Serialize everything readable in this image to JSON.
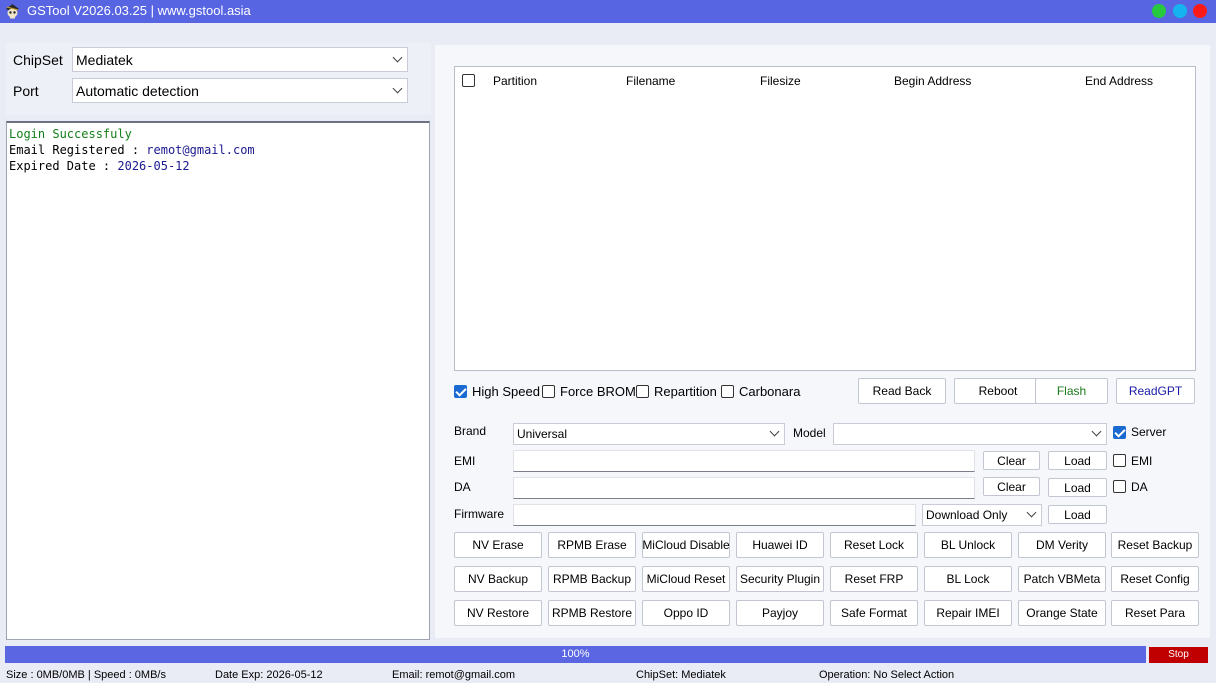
{
  "window": {
    "title": "GSTool V2026.03.25 | www.gstool.asia",
    "app_icon": "pirate-skull-icon",
    "controls": [
      {
        "name": "maximize",
        "color": "#27c93f"
      },
      {
        "name": "minimize",
        "color": "#15b4f0"
      },
      {
        "name": "close",
        "color": "#ff1a1a"
      }
    ]
  },
  "connection": {
    "chipset_label": "ChipSet",
    "chipset_value": "Mediatek",
    "port_label": "Port",
    "port_value": "Automatic detection"
  },
  "log": {
    "line1": "Login Successfuly",
    "line2_key": "Email Registered : ",
    "line2_value": "remot@gmail.com",
    "line3_key": "Expired Date : ",
    "line3_value": "2026-05-12"
  },
  "partition_table": {
    "headers": [
      "Partition",
      "Filename",
      "Filesize",
      "Begin Address",
      "End Address"
    ],
    "select_all_checked": false
  },
  "options": {
    "high_speed": {
      "label": "High Speed",
      "checked": true
    },
    "force_brom": {
      "label": "Force BROM",
      "checked": false
    },
    "repartition": {
      "label": "Repartition",
      "checked": false
    },
    "carbonara": {
      "label": "Carbonara",
      "checked": false
    }
  },
  "actions": {
    "read_back": "Read Back",
    "reboot": "Reboot",
    "flash": "Flash",
    "read_gpt": "ReadGPT"
  },
  "form": {
    "brand_label": "Brand",
    "brand_value": "Universal",
    "model_label": "Model",
    "model_value": "",
    "server": {
      "label": "Server",
      "checked": true
    },
    "emi_label": "EMI",
    "emi_value": "",
    "emi_check": {
      "label": "EMI",
      "checked": false
    },
    "da_label": "DA",
    "da_value": "",
    "da_check": {
      "label": "DA",
      "checked": false
    },
    "firmware_label": "Firmware",
    "firmware_value": "",
    "firmware_mode": "Download Only",
    "clear_label": "Clear",
    "load_label": "Load"
  },
  "functions": {
    "row1": [
      "NV Erase",
      "RPMB Erase",
      "MiCloud Disable",
      "Huawei ID",
      "Reset Lock",
      "BL Unlock",
      "DM Verity",
      "Reset Backup"
    ],
    "row2": [
      "NV Backup",
      "RPMB Backup",
      "MiCloud Reset",
      "Security Plugin",
      "Reset FRP",
      "BL Lock",
      "Patch VBMeta",
      "Reset Config"
    ],
    "row3": [
      "NV Restore",
      "RPMB Restore",
      "Oppo ID",
      "Payjoy",
      "Safe Format",
      "Repair IMEI",
      "Orange State",
      "Reset Para"
    ]
  },
  "progress": {
    "percent": 100,
    "text": "100%",
    "stop_label": "Stop"
  },
  "status_bar": {
    "size_speed": "Size : 0MB/0MB | Speed : 0MB/s",
    "date_exp": "Date Exp: 2026-05-12",
    "email": "Email: remot@gmail.com",
    "chipset": "ChipSet: Mediatek",
    "operation": "Operation: No Select Action"
  },
  "colors": {
    "accent": "#5865e3",
    "flash_text": "#1d7a1d",
    "readgpt_text": "#1a1aa6",
    "stop_bg": "#c00000"
  }
}
